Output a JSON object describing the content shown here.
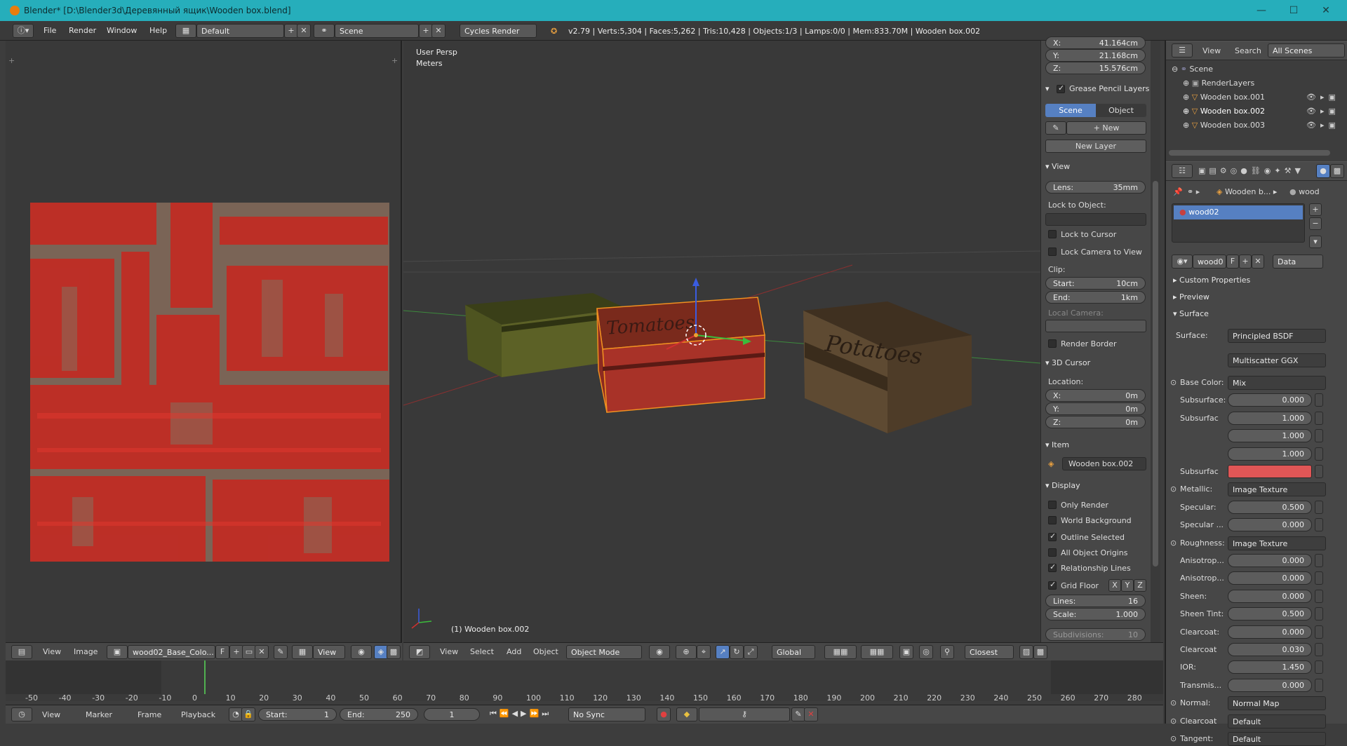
{
  "titlebar": {
    "title": "Blender* [D:\\Blender3d\\Деревянный ящик\\Wooden box.blend]"
  },
  "infobar": {
    "menus": [
      "File",
      "Render",
      "Window",
      "Help"
    ],
    "screen_layout": "Default",
    "scene": "Scene",
    "engine": "Cycles Render",
    "stats": "v2.79 | Verts:5,304 | Faces:5,262 | Tris:10,428 | Objects:1/3 | Lamps:0/0 | Mem:833.70M | Wooden box.002"
  },
  "viewport": {
    "persp": "User Persp",
    "units": "Meters",
    "active_label": "(1) Wooden box.002",
    "crate_left_text": "Tomatoes",
    "crate_right_text": "Potatoes",
    "header": {
      "menus": [
        "View",
        "Select",
        "Add",
        "Object"
      ],
      "mode": "Object Mode",
      "orientation": "Global",
      "snap": "Closest"
    }
  },
  "uv_editor": {
    "header": {
      "menus": [
        "View",
        "Image"
      ],
      "image": "wood02_Base_Colo...",
      "fake": "F",
      "view": "View"
    }
  },
  "npanel": {
    "cursor_x": "41.164cm",
    "cursor_y": "21.168cm",
    "cursor_z": "15.576cm",
    "xyz": [
      "X:",
      "Y:",
      "Z:"
    ],
    "grease": "Grease Pencil Layers",
    "scene_btn": "Scene",
    "object_btn": "Object",
    "new_btn": "New",
    "new_layer": "New Layer",
    "view_title": "View",
    "lens_label": "Lens:",
    "lens": "35mm",
    "lock_obj": "Lock to Object:",
    "lock_cursor": "Lock to Cursor",
    "lock_camera": "Lock Camera to View",
    "clip": "Clip:",
    "start_label": "Start:",
    "start": "10cm",
    "end_label": "End:",
    "end": "1km",
    "local_cam": "Local Camera:",
    "render_border": "Render Border",
    "cursor_title": "3D Cursor",
    "location": "Location:",
    "loc_x": "0m",
    "loc_y": "0m",
    "loc_z": "0m",
    "item_title": "Item",
    "item_name": "Wooden box.002",
    "display_title": "Display",
    "only_render": "Only Render",
    "world_bg": "World Background",
    "outline_sel": "Outline Selected",
    "all_origins": "All Object Origins",
    "rel_lines": "Relationship Lines",
    "grid_floor": "Grid Floor",
    "axes": [
      "X",
      "Y",
      "Z"
    ],
    "lines_label": "Lines:",
    "lines": "16",
    "scale_label": "Scale:",
    "scale": "1.000",
    "subdiv_label": "Subdivisions:",
    "subdiv": "10"
  },
  "outliner": {
    "menus": [
      "View",
      "Search"
    ],
    "filter": "All Scenes",
    "scene": "Scene",
    "items": [
      "RenderLayers",
      "Wooden box.001",
      "Wooden box.002",
      "Wooden box.003"
    ]
  },
  "props": {
    "breadcrumb_obj": "Wooden b...",
    "breadcrumb_mat": "wood",
    "material_slot": "wood02",
    "mat_name": "wood0",
    "fake": "F",
    "link": "Data",
    "sections": [
      "Custom Properties",
      "Preview",
      "Surface"
    ],
    "surface_label": "Surface:",
    "surface": "Principled BSDF",
    "distribution": "Multiscatter GGX",
    "rows": [
      {
        "label": "Base Color:",
        "value": "Mix",
        "type": "dd"
      },
      {
        "label": "Subsurface:",
        "value": "0.000",
        "type": "num"
      },
      {
        "label": "Subsurfac",
        "value": "1.000",
        "type": "num"
      },
      {
        "label": "",
        "value": "1.000",
        "type": "num"
      },
      {
        "label": "",
        "value": "1.000",
        "type": "num"
      },
      {
        "label": "Subsurfac",
        "value": "",
        "type": "color"
      },
      {
        "label": "Metallic:",
        "value": "Image Texture",
        "type": "dd"
      },
      {
        "label": "Specular:",
        "value": "0.500",
        "type": "num"
      },
      {
        "label": "Specular ...",
        "value": "0.000",
        "type": "num"
      },
      {
        "label": "Roughness:",
        "value": "Image Texture",
        "type": "dd"
      },
      {
        "label": "Anisotrop...",
        "value": "0.000",
        "type": "num"
      },
      {
        "label": "Anisotrop...",
        "value": "0.000",
        "type": "num"
      },
      {
        "label": "Sheen:",
        "value": "0.000",
        "type": "num"
      },
      {
        "label": "Sheen Tint:",
        "value": "0.500",
        "type": "num"
      },
      {
        "label": "Clearcoat:",
        "value": "0.000",
        "type": "num"
      },
      {
        "label": "Clearcoat",
        "value": "0.030",
        "type": "num"
      },
      {
        "label": "IOR:",
        "value": "1.450",
        "type": "num"
      },
      {
        "label": "Transmis...",
        "value": "0.000",
        "type": "num"
      },
      {
        "label": "Normal:",
        "value": "Normal Map",
        "type": "dd"
      },
      {
        "label": "Clearcoat",
        "value": "Default",
        "type": "dd"
      },
      {
        "label": "Tangent:",
        "value": "Default",
        "type": "dd"
      }
    ],
    "subsurface_color": "#e05656"
  },
  "timeline": {
    "ticks": [
      "-50",
      "-40",
      "-30",
      "-20",
      "-10",
      "0",
      "10",
      "20",
      "30",
      "40",
      "50",
      "60",
      "70",
      "80",
      "90",
      "100",
      "110",
      "120",
      "130",
      "140",
      "150",
      "160",
      "170",
      "180",
      "190",
      "200",
      "210",
      "220",
      "230",
      "240",
      "250",
      "260",
      "270",
      "280"
    ],
    "menus": [
      "View",
      "Marker",
      "Frame",
      "Playback"
    ],
    "start_label": "Start:",
    "start": "1",
    "end_label": "End:",
    "end": "250",
    "current": "1",
    "sync": "No Sync"
  }
}
